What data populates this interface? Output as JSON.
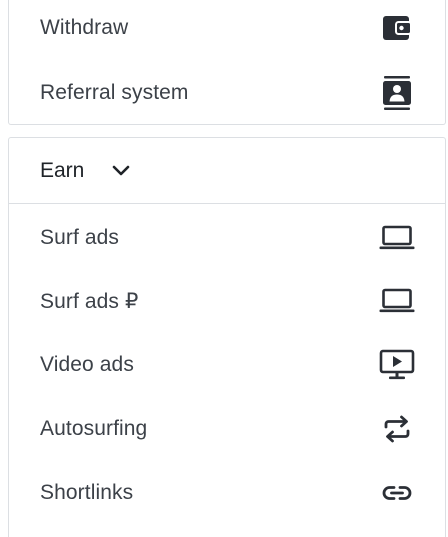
{
  "menu": {
    "top_items": [
      {
        "label": "Withdraw",
        "icon": "wallet-icon"
      },
      {
        "label": "Referral system",
        "icon": "contact-card-icon"
      }
    ],
    "earn": {
      "label": "Earn",
      "chevron_icon": "chevron-down-icon",
      "items": [
        {
          "label": "Surf ads",
          "icon": "laptop-icon"
        },
        {
          "label": "Surf ads ₽",
          "icon": "laptop-icon"
        },
        {
          "label": "Video ads",
          "icon": "video-play-icon"
        },
        {
          "label": "Autosurfing",
          "icon": "repeat-icon"
        },
        {
          "label": "Shortlinks",
          "icon": "link-icon"
        }
      ]
    }
  },
  "colors": {
    "icon": "#2b2f36",
    "text": "#3c4148",
    "border": "#dcdfe3"
  }
}
